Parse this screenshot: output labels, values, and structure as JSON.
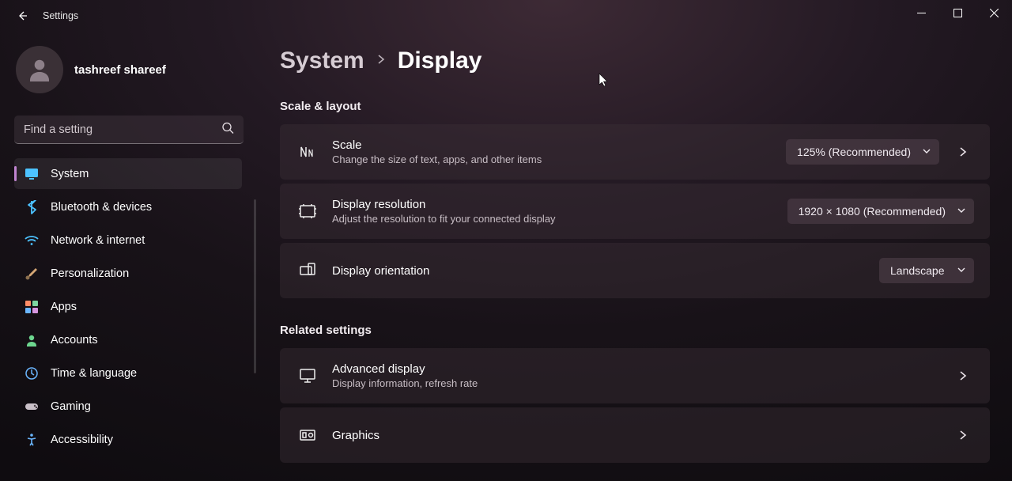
{
  "window": {
    "title": "Settings"
  },
  "user": {
    "name": "tashreef shareef"
  },
  "search": {
    "placeholder": "Find a setting"
  },
  "sidebar": {
    "items": [
      {
        "label": "System"
      },
      {
        "label": "Bluetooth & devices"
      },
      {
        "label": "Network & internet"
      },
      {
        "label": "Personalization"
      },
      {
        "label": "Apps"
      },
      {
        "label": "Accounts"
      },
      {
        "label": "Time & language"
      },
      {
        "label": "Gaming"
      },
      {
        "label": "Accessibility"
      }
    ]
  },
  "breadcrumb": {
    "parent": "System",
    "current": "Display"
  },
  "sections": {
    "scale_layout": {
      "title": "Scale & layout",
      "scale": {
        "title": "Scale",
        "desc": "Change the size of text, apps, and other items",
        "value": "125% (Recommended)"
      },
      "resolution": {
        "title": "Display resolution",
        "desc": "Adjust the resolution to fit your connected display",
        "value": "1920 × 1080 (Recommended)"
      },
      "orientation": {
        "title": "Display orientation",
        "value": "Landscape"
      }
    },
    "related": {
      "title": "Related settings",
      "advanced": {
        "title": "Advanced display",
        "desc": "Display information, refresh rate"
      },
      "graphics": {
        "title": "Graphics"
      }
    }
  }
}
